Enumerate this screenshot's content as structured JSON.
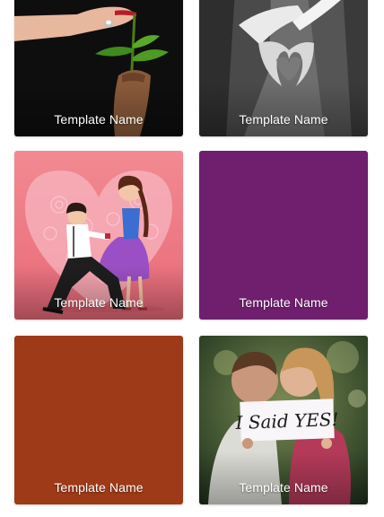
{
  "templates": [
    {
      "name": "Template Name",
      "image": "hand-ring-plant",
      "color": "#111111"
    },
    {
      "name": "Template Name",
      "image": "hands-heart-bw",
      "color": "#8a8a8a"
    },
    {
      "name": "Template Name",
      "image": "proposal-illustration",
      "color": "#f07f88"
    },
    {
      "name": "Template Name",
      "image": "solid-purple",
      "color": "#6f1f6e"
    },
    {
      "name": "Template Name",
      "image": "solid-rust",
      "color": "#9e3a17"
    },
    {
      "name": "Template Name",
      "image": "couple-i-said-yes",
      "color": "#4a5a3a",
      "sign_text": "I Said YES!"
    }
  ]
}
